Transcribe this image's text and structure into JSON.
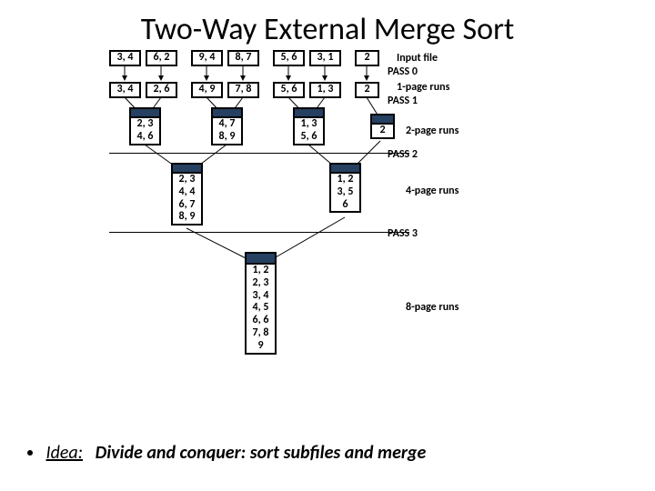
{
  "title": "Two-Way External Merge Sort",
  "rows": {
    "input": [
      "3, 4",
      "6, 2",
      "9, 4",
      "8, 7",
      "5, 6",
      "3, 1",
      "2"
    ],
    "pass0": [
      "3, 4",
      "2, 6",
      "4, 9",
      "7, 8",
      "5, 6",
      "1, 3",
      "2"
    ],
    "pass1": [
      "2, 3\n4, 6",
      "4, 7\n8, 9",
      "1, 3\n5, 6",
      "2"
    ],
    "pass2": [
      "2, 3\n4, 4\n6, 7\n8, 9",
      "1, 2\n3, 5\n6"
    ],
    "pass3": [
      "1, 2\n2, 3\n3, 4\n4, 5\n6, 6\n7, 8\n9"
    ]
  },
  "labels": {
    "input": "Input file",
    "p0": "PASS 0",
    "r1": "1-page runs",
    "p1": "PASS 1",
    "r2": "2-page runs",
    "p2": "PASS 2",
    "r4": "4-page runs",
    "p3": "PASS 3",
    "r8": "8-page runs"
  },
  "bullet": {
    "idea": "Idea:",
    "text": "Divide and conquer: sort subfiles and merge"
  }
}
